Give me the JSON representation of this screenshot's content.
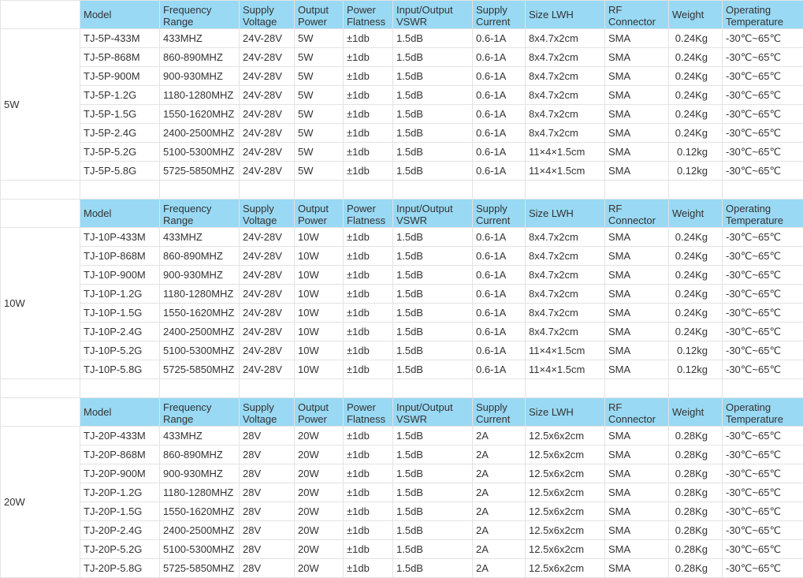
{
  "headers": [
    "Model",
    "Frequency\nRange",
    "Supply\nVoltage",
    "Output\nPower",
    "Power\nFlatness",
    "Input/Output\nVSWR",
    "Supply\nCurrent",
    "Size LWH",
    "RF\nConnector",
    "Weight",
    "Operating\nTemperature"
  ],
  "groups": [
    {
      "label": "5W",
      "rows": [
        [
          "TJ-5P-433M",
          "433MHZ",
          "24V-28V",
          "5W",
          "±1db",
          "1.5dB",
          "0.6-1A",
          "8x4.7x2cm",
          "SMA",
          "0.24Kg",
          "-30℃~65℃"
        ],
        [
          "TJ-5P-868M",
          "860-890MHZ",
          "24V-28V",
          "5W",
          "±1db",
          "1.5dB",
          "0.6-1A",
          "8x4.7x2cm",
          "SMA",
          "0.24Kg",
          "-30℃~65℃"
        ],
        [
          "TJ-5P-900M",
          "900-930MHZ",
          "24V-28V",
          "5W",
          "±1db",
          "1.5dB",
          "0.6-1A",
          "8x4.7x2cm",
          "SMA",
          "0.24Kg",
          "-30℃~65℃"
        ],
        [
          "TJ-5P-1.2G",
          "1180-1280MHZ",
          "24V-28V",
          "5W",
          "±1db",
          "1.5dB",
          "0.6-1A",
          "8x4.7x2cm",
          "SMA",
          "0.24Kg",
          "-30℃~65℃"
        ],
        [
          "TJ-5P-1.5G",
          "1550-1620MHZ",
          "24V-28V",
          "5W",
          "±1db",
          "1.5dB",
          "0.6-1A",
          "8x4.7x2cm",
          "SMA",
          "0.24Kg",
          "-30℃~65℃"
        ],
        [
          "TJ-5P-2.4G",
          "2400-2500MHZ",
          "24V-28V",
          "5W",
          "±1db",
          "1.5dB",
          "0.6-1A",
          "8x4.7x2cm",
          "SMA",
          "0.24Kg",
          "-30℃~65℃"
        ],
        [
          "TJ-5P-5.2G",
          "5100-5300MHZ",
          "24V-28V",
          "5W",
          "±1db",
          "1.5dB",
          "0.6-1A",
          "11×4×1.5cm",
          "SMA",
          "0.12kg",
          "-30℃~65℃"
        ],
        [
          "TJ-5P-5.8G",
          "5725-5850MHZ",
          "24V-28V",
          "5W",
          "±1db",
          "1.5dB",
          "0.6-1A",
          "11×4×1.5cm",
          "SMA",
          "0.12kg",
          "-30℃~65℃"
        ]
      ]
    },
    {
      "label": "10W",
      "rows": [
        [
          "TJ-10P-433M",
          "433MHZ",
          "24V-28V",
          "10W",
          "±1db",
          "1.5dB",
          "0.6-1A",
          "8x4.7x2cm",
          "SMA",
          "0.24Kg",
          "-30℃~65℃"
        ],
        [
          "TJ-10P-868M",
          "860-890MHZ",
          "24V-28V",
          "10W",
          "±1db",
          "1.5dB",
          "0.6-1A",
          "8x4.7x2cm",
          "SMA",
          "0.24Kg",
          "-30℃~65℃"
        ],
        [
          "TJ-10P-900M",
          "900-930MHZ",
          "24V-28V",
          "10W",
          "±1db",
          "1.5dB",
          "0.6-1A",
          "8x4.7x2cm",
          "SMA",
          "0.24Kg",
          "-30℃~65℃"
        ],
        [
          "TJ-10P-1.2G",
          "1180-1280MHZ",
          "24V-28V",
          "10W",
          "±1db",
          "1.5dB",
          "0.6-1A",
          "8x4.7x2cm",
          "SMA",
          "0.24Kg",
          "-30℃~65℃"
        ],
        [
          "TJ-10P-1.5G",
          "1550-1620MHZ",
          "24V-28V",
          "10W",
          "±1db",
          "1.5dB",
          "0.6-1A",
          "8x4.7x2cm",
          "SMA",
          "0.24Kg",
          "-30℃~65℃"
        ],
        [
          "TJ-10P-2.4G",
          "2400-2500MHZ",
          "24V-28V",
          "10W",
          "±1db",
          "1.5dB",
          "0.6-1A",
          "8x4.7x2cm",
          "SMA",
          "0.24Kg",
          "-30℃~65℃"
        ],
        [
          "TJ-10P-5.2G",
          "5100-5300MHZ",
          "24V-28V",
          "10W",
          "±1db",
          "1.5dB",
          "0.6-1A",
          "11×4×1.5cm",
          "SMA",
          "0.12kg",
          "-30℃~65℃"
        ],
        [
          "TJ-10P-5.8G",
          "5725-5850MHZ",
          "24V-28V",
          "10W",
          "±1db",
          "1.5dB",
          "0.6-1A",
          "11×4×1.5cm",
          "SMA",
          "0.12kg",
          "-30℃~65℃"
        ]
      ]
    },
    {
      "label": "20W",
      "rows": [
        [
          "TJ-20P-433M",
          "433MHZ",
          "28V",
          "20W",
          "±1db",
          "1.5dB",
          "2A",
          "12.5x6x2cm",
          "SMA",
          "0.28Kg",
          "-30℃~65℃"
        ],
        [
          "TJ-20P-868M",
          "860-890MHZ",
          "28V",
          "20W",
          "±1db",
          "1.5dB",
          "2A",
          "12.5x6x2cm",
          "SMA",
          "0.28Kg",
          "-30℃~65℃"
        ],
        [
          "TJ-20P-900M",
          "900-930MHZ",
          "28V",
          "20W",
          "±1db",
          "1.5dB",
          "2A",
          "12.5x6x2cm",
          "SMA",
          "0.28Kg",
          "-30℃~65℃"
        ],
        [
          "TJ-20P-1.2G",
          "1180-1280MHZ",
          "28V",
          "20W",
          "±1db",
          "1.5dB",
          "2A",
          "12.5x6x2cm",
          "SMA",
          "0.28Kg",
          "-30℃~65℃"
        ],
        [
          "TJ-20P-1.5G",
          "1550-1620MHZ",
          "28V",
          "20W",
          "±1db",
          "1.5dB",
          "2A",
          "12.5x6x2cm",
          "SMA",
          "0.28Kg",
          "-30℃~65℃"
        ],
        [
          "TJ-20P-2.4G",
          "2400-2500MHZ",
          "28V",
          "20W",
          "±1db",
          "1.5dB",
          "2A",
          "12.5x6x2cm",
          "SMA",
          "0.28Kg",
          "-30℃~65℃"
        ],
        [
          "TJ-20P-5.2G",
          "5100-5300MHZ",
          "28V",
          "20W",
          "±1db",
          "1.5dB",
          "2A",
          "12.5x6x2cm",
          "SMA",
          "0.28Kg",
          "-30℃~65℃"
        ],
        [
          "TJ-20P-5.8G",
          "5725-5850MHZ",
          "28V",
          "20W",
          "±1db",
          "1.5dB",
          "2A",
          "12.5x6x2cm",
          "SMA",
          "0.28Kg",
          "-30℃~65℃"
        ]
      ]
    }
  ],
  "colors": {
    "header_bg": "#99d9f4",
    "border": "#e3e3e3",
    "text": "#333333"
  }
}
